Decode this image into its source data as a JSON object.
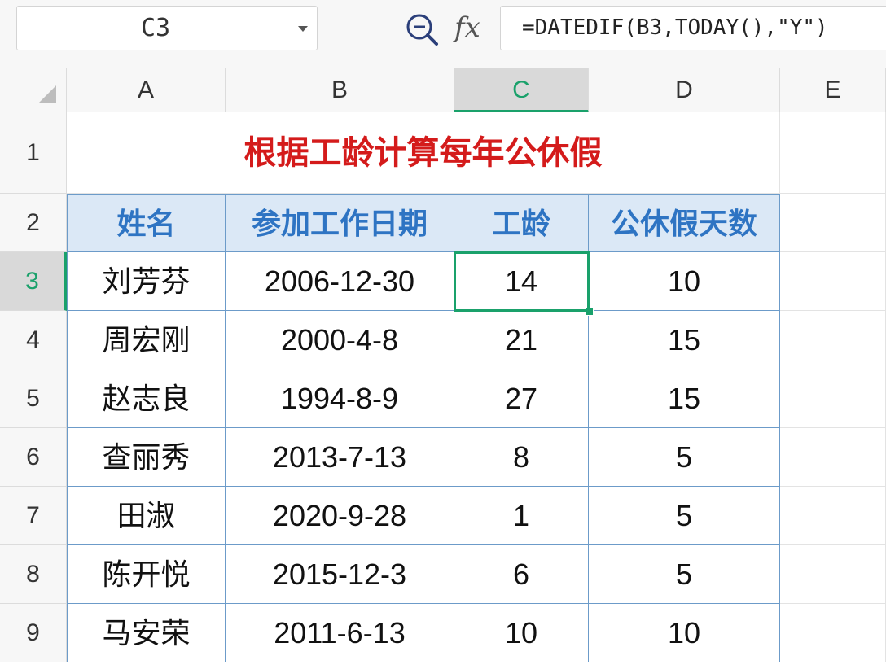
{
  "formula_bar": {
    "name_box": "C3",
    "fx_label": "fx",
    "formula": "=DATEDIF(B3,TODAY(),\"Y\")",
    "icons": [
      "chevron-down-icon",
      "zoom-formula-icon"
    ]
  },
  "columns": [
    "A",
    "B",
    "C",
    "D",
    "E"
  ],
  "rows": [
    "1",
    "2",
    "3",
    "4",
    "5",
    "6",
    "7",
    "8",
    "9"
  ],
  "active_cell": {
    "column": "C",
    "row": "3"
  },
  "accent_color": "#1aa16b",
  "sheet": {
    "title": "根据工龄计算每年公休假",
    "headers": [
      "姓名",
      "参加工作日期",
      "工龄",
      "公休假天数"
    ],
    "records": [
      [
        "刘芳芬",
        "2006-12-30",
        "14",
        "10"
      ],
      [
        "周宏刚",
        "2000-4-8",
        "21",
        "15"
      ],
      [
        "赵志良",
        "1994-8-9",
        "27",
        "15"
      ],
      [
        "查丽秀",
        "2013-7-13",
        "8",
        "5"
      ],
      [
        "田淑",
        "2020-9-28",
        "1",
        "5"
      ],
      [
        "陈开悦",
        "2015-12-3",
        "6",
        "5"
      ],
      [
        "马安荣",
        "2011-6-13",
        "10",
        "10"
      ]
    ]
  }
}
